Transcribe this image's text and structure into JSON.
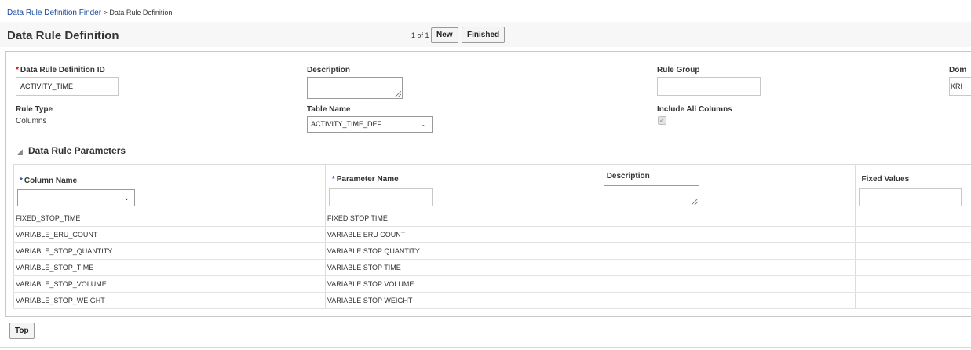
{
  "breadcrumb": {
    "link": "Data Rule Definition Finder",
    "separator": ">",
    "current": "Data Rule Definition"
  },
  "header": {
    "title": "Data Rule Definition",
    "pager": "1 of 1",
    "new_label": "New",
    "finished_label": "Finished"
  },
  "form": {
    "rule_id_label": "Data Rule Definition ID",
    "rule_id_value": "ACTIVITY_TIME",
    "description_label": "Description",
    "rule_group_label": "Rule Group",
    "domain_label": "Dom",
    "domain_value": "KRI",
    "rule_type_label": "Rule Type",
    "rule_type_value": "Columns",
    "table_name_label": "Table Name",
    "table_name_value": "ACTIVITY_TIME_DEF",
    "include_all_label": "Include All Columns",
    "include_all_checked": true
  },
  "params": {
    "section_title": "Data Rule Parameters",
    "columns": {
      "column_name": "Column Name",
      "parameter_name": "Parameter Name",
      "description": "Description",
      "fixed_values": "Fixed Values"
    },
    "rows": [
      {
        "column": "FIXED_STOP_TIME",
        "parameter": "FIXED STOP TIME"
      },
      {
        "column": "VARIABLE_ERU_COUNT",
        "parameter": "VARIABLE ERU COUNT"
      },
      {
        "column": "VARIABLE_STOP_QUANTITY",
        "parameter": "VARIABLE STOP QUANTITY"
      },
      {
        "column": "VARIABLE_STOP_TIME",
        "parameter": "VARIABLE STOP TIME"
      },
      {
        "column": "VARIABLE_STOP_VOLUME",
        "parameter": "VARIABLE STOP VOLUME"
      },
      {
        "column": "VARIABLE_STOP_WEIGHT",
        "parameter": "VARIABLE STOP WEIGHT"
      }
    ]
  },
  "footer": {
    "top_label": "Top"
  },
  "icons": {
    "collapse": "triangle-down-icon",
    "dropdown": "chevron-down-icon",
    "check": "check-icon",
    "resize": "resize-grip-icon"
  },
  "colors": {
    "link": "#1a4aa0",
    "required": "#d40000",
    "band": "#f7f7f7",
    "border": "#c8c8c8"
  }
}
